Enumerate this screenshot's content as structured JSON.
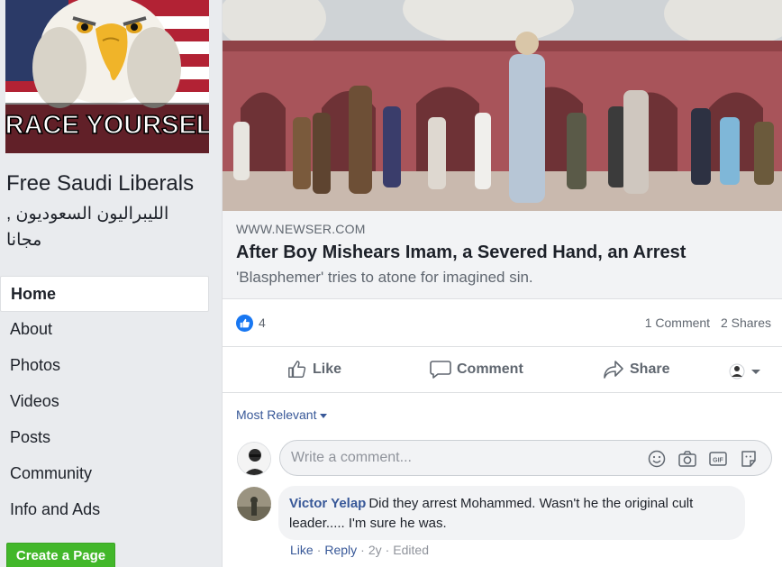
{
  "sidebar": {
    "profile_caption": "BRACE YOURSELF",
    "page_name": "Free Saudi Liberals",
    "page_name_arabic": "الليبراليون السعوديون , مجانا",
    "nav": [
      {
        "label": "Home",
        "active": true
      },
      {
        "label": "About"
      },
      {
        "label": "Photos"
      },
      {
        "label": "Videos"
      },
      {
        "label": "Posts"
      },
      {
        "label": "Community"
      },
      {
        "label": "Info and Ads"
      }
    ],
    "create_page_label": "Create a Page"
  },
  "post": {
    "link": {
      "domain": "WWW.NEWSER.COM",
      "title": "After Boy Mishears Imam, a Severed Hand, an Arrest",
      "description": "'Blasphemer' tries to atone for imagined sin."
    },
    "like_count": "4",
    "comments_count": "1 Comment",
    "shares_count": "2 Shares",
    "actions": {
      "like": "Like",
      "comment": "Comment",
      "share": "Share"
    },
    "sort_label": "Most Relevant",
    "comment_placeholder": "Write a comment...",
    "comments": [
      {
        "author": "Victor Yelap",
        "text": "Did they arrest Mohammed. Wasn't he the original cult leader..... I'm sure he was.",
        "actions": {
          "like": "Like",
          "reply": "Reply",
          "age": "2y",
          "edited": "Edited"
        }
      }
    ]
  },
  "colors": {
    "link_blue": "#385898",
    "facebook_blue": "#1877f2",
    "green": "#42b72a",
    "grey_text": "#606770"
  }
}
